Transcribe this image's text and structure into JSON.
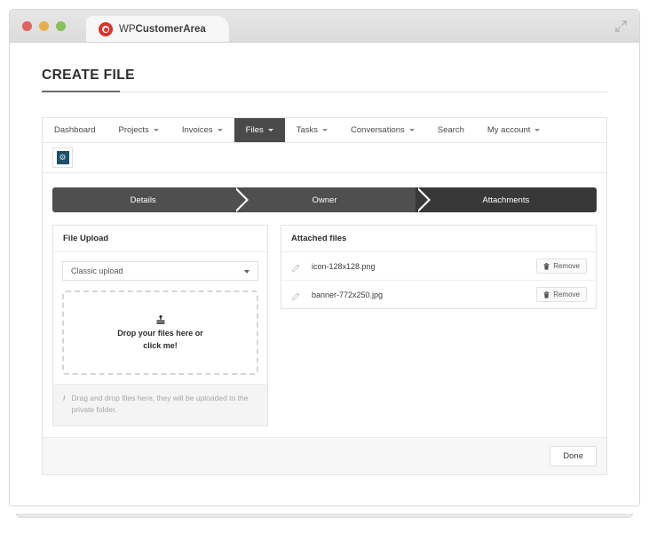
{
  "browser": {
    "tab_title_prefix": "WP",
    "tab_title_main": "CustomerArea",
    "tab_title_full": "WPCustomerArea",
    "favicon_name": "wpcustomerarea-logo-icon",
    "expand_icon": "expand-arrows-icon",
    "traffic_lights": [
      "close-red",
      "minimize-yellow",
      "maximize-green"
    ]
  },
  "page": {
    "title": "CREATE FILE"
  },
  "nav": {
    "items": [
      {
        "label": "Dashboard",
        "has_caret": false,
        "active": false
      },
      {
        "label": "Projects",
        "has_caret": true,
        "active": false
      },
      {
        "label": "Invoices",
        "has_caret": true,
        "active": false
      },
      {
        "label": "Files",
        "has_caret": true,
        "active": true
      },
      {
        "label": "Tasks",
        "has_caret": true,
        "active": false
      },
      {
        "label": "Conversations",
        "has_caret": true,
        "active": false
      },
      {
        "label": "Search",
        "has_caret": false,
        "active": false
      },
      {
        "label": "My account",
        "has_caret": true,
        "active": false
      }
    ]
  },
  "toolbar": {
    "button_name": "settings-icon",
    "glyph": "⚙"
  },
  "steps": [
    {
      "label": "Details",
      "state": "done"
    },
    {
      "label": "Owner",
      "state": "done"
    },
    {
      "label": "Attachments",
      "state": "active"
    }
  ],
  "file_upload": {
    "heading": "File Upload",
    "select": {
      "value": "Classic upload",
      "options": [
        "Classic upload"
      ]
    },
    "dropzone": {
      "icon": "upload-icon",
      "line1": "Drop your files here or",
      "line2": "click me!"
    },
    "note": {
      "icon": "info-icon",
      "icon_glyph": "i",
      "text": "Drag and drop files here, they will be uploaded to the private folder."
    }
  },
  "attached_files": {
    "heading": "Attached files",
    "remove_label": "Remove",
    "rows": [
      {
        "name": "icon-128x128.png",
        "edit_icon": "edit-pencil-icon",
        "remove_icon": "trash-icon"
      },
      {
        "name": "banner-772x250.jpg",
        "edit_icon": "edit-pencil-icon",
        "remove_icon": "trash-icon"
      }
    ]
  },
  "footer": {
    "done_label": "Done"
  },
  "colors": {
    "nav_active_bg": "#4a4a4a",
    "step_done_bg": "#4f4f4f",
    "step_active_bg": "#383838",
    "title_underline": "#6b6b6b",
    "favicon": "#d8342b",
    "toolbar_icon": "#1f4e68"
  }
}
